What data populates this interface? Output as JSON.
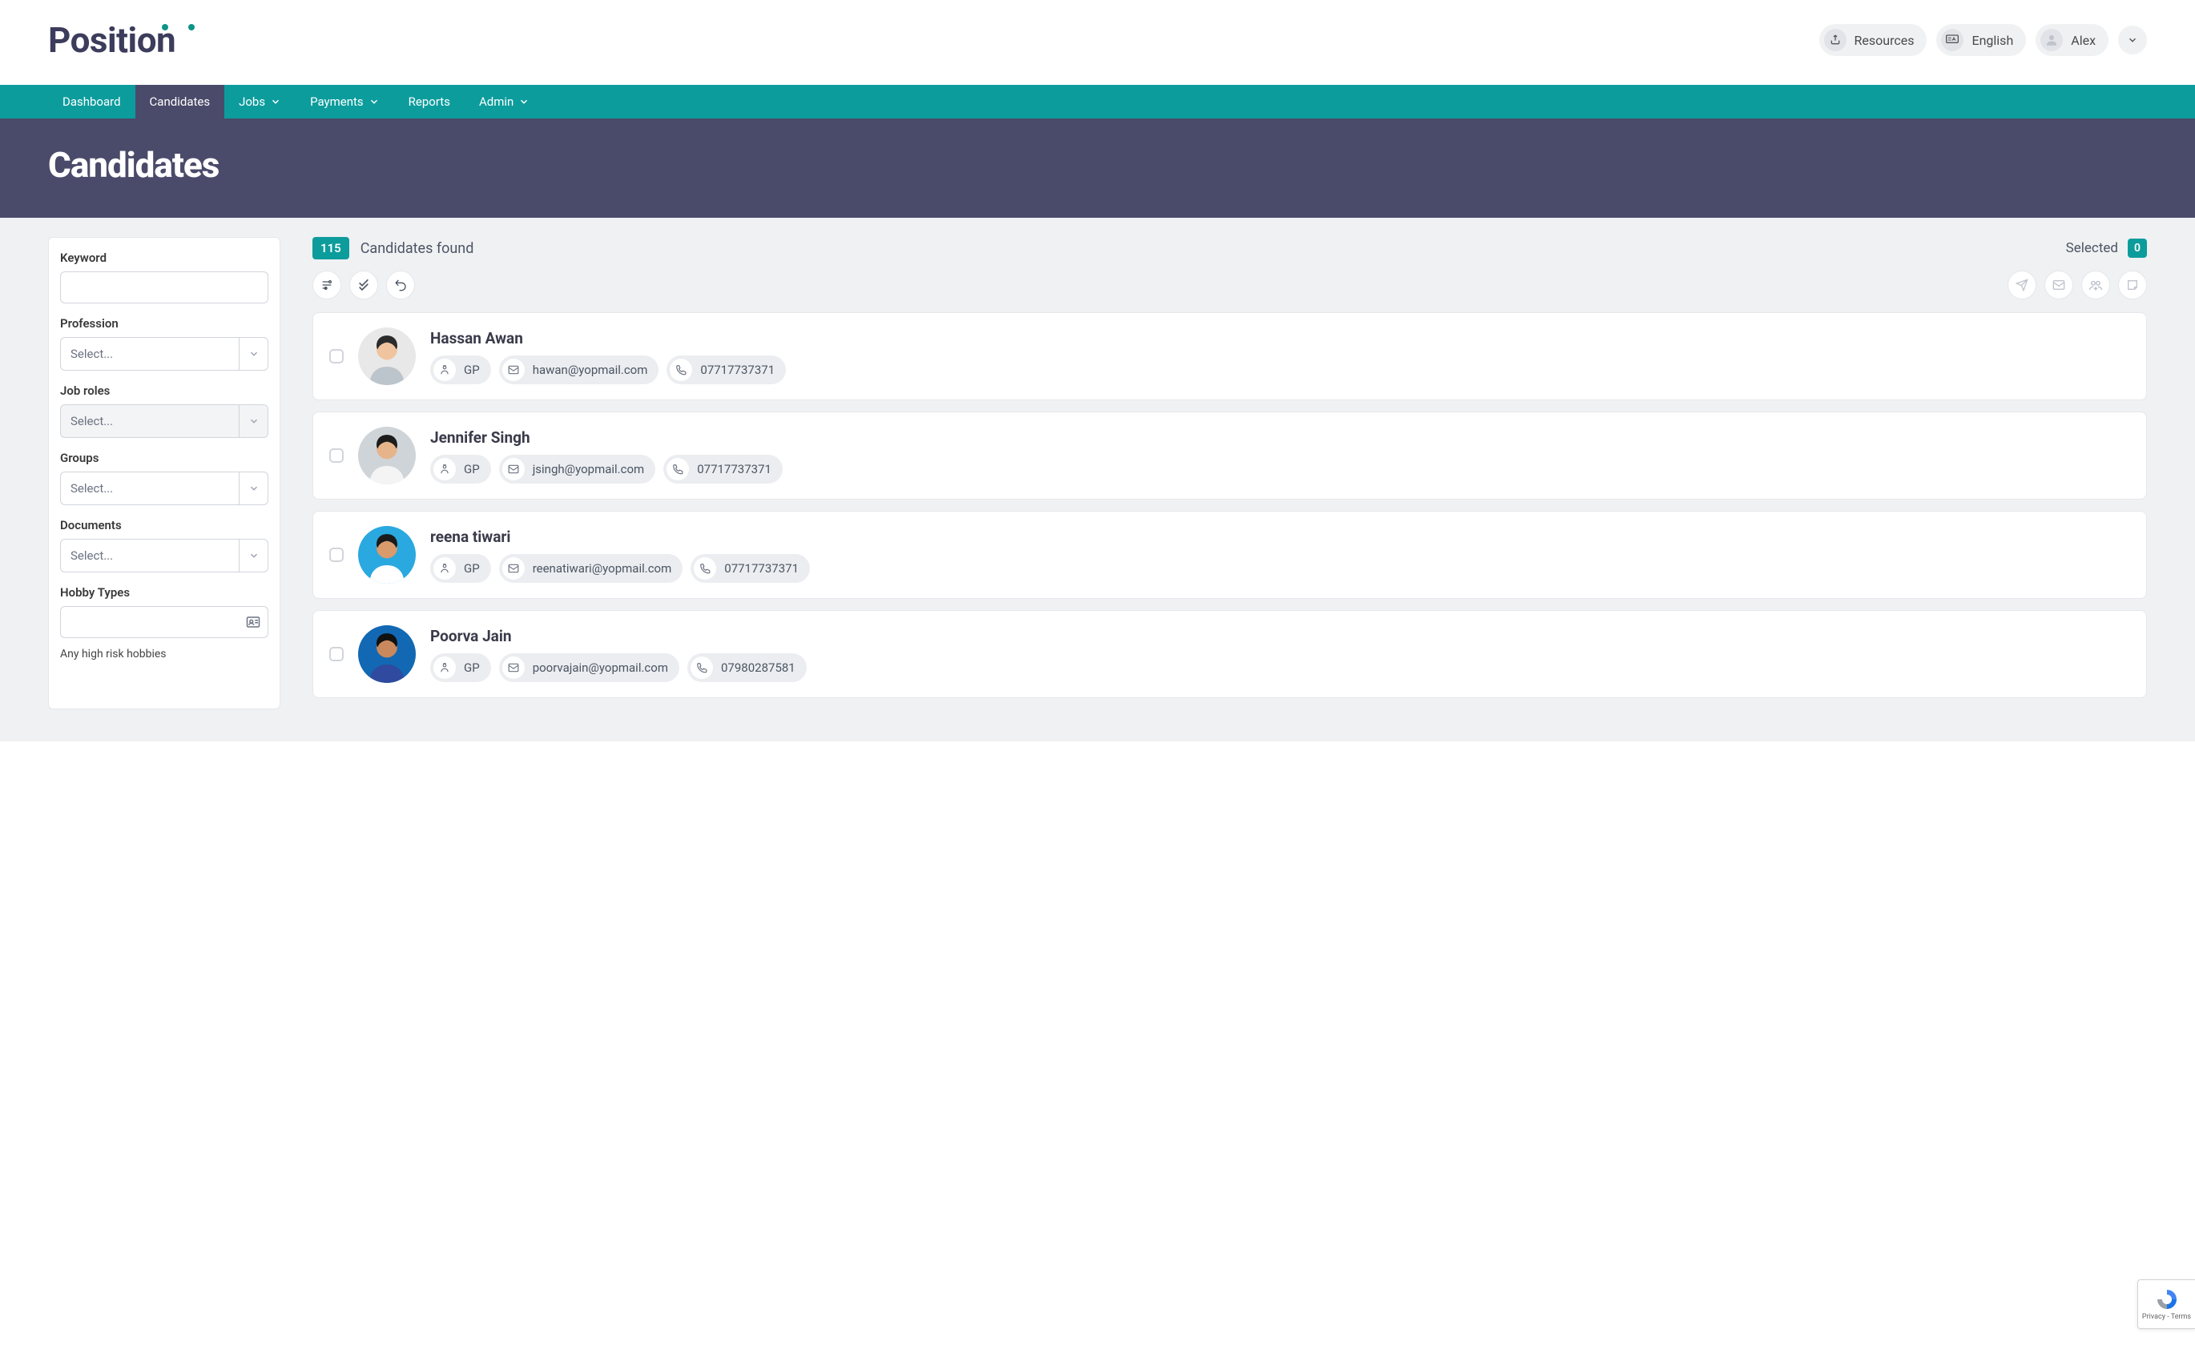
{
  "header": {
    "logo_text": "Position",
    "resources_label": "Resources",
    "language_label": "English",
    "user_name": "Alex"
  },
  "nav": {
    "items": [
      {
        "label": "Dashboard",
        "dropdown": false
      },
      {
        "label": "Candidates",
        "dropdown": false,
        "active": true
      },
      {
        "label": "Jobs",
        "dropdown": true
      },
      {
        "label": "Payments",
        "dropdown": true
      },
      {
        "label": "Reports",
        "dropdown": false
      },
      {
        "label": "Admin",
        "dropdown": true
      }
    ]
  },
  "page": {
    "title": "Candidates"
  },
  "filters": {
    "keyword": {
      "label": "Keyword",
      "value": ""
    },
    "profession": {
      "label": "Profession",
      "placeholder": "Select..."
    },
    "job_roles": {
      "label": "Job roles",
      "placeholder": "Select...",
      "disabled": true
    },
    "groups": {
      "label": "Groups",
      "placeholder": "Select..."
    },
    "documents": {
      "label": "Documents",
      "placeholder": "Select..."
    },
    "hobby_types": {
      "label": "Hobby Types",
      "value": "",
      "hint": "Any high risk hobbies"
    }
  },
  "summary": {
    "count": "115",
    "found_label": "Candidates found",
    "selected_label": "Selected",
    "selected_count": "0"
  },
  "candidates": [
    {
      "name": "Hassan Awan",
      "role": "GP",
      "email": "hawan@yopmail.com",
      "phone": "07717737371"
    },
    {
      "name": "Jennifer Singh",
      "role": "GP",
      "email": "jsingh@yopmail.com",
      "phone": "07717737371"
    },
    {
      "name": "reena tiwari",
      "role": "GP",
      "email": "reenatiwari@yopmail.com",
      "phone": "07717737371"
    },
    {
      "name": "Poorva Jain",
      "role": "GP",
      "email": "poorvajain@yopmail.com",
      "phone": "07980287581"
    }
  ],
  "recaptcha": {
    "line1": "Privacy",
    "line2": "Terms"
  },
  "avatar_colors": [
    {
      "bg": "#e8e8e8",
      "skin": "#f0c49e",
      "hair": "#2b2b2b",
      "shirt": "#bcc4cc"
    },
    {
      "bg": "#cfd4d9",
      "skin": "#e6b48a",
      "hair": "#1c1c1c",
      "shirt": "#f4f4f4"
    },
    {
      "bg": "#2aa8e0",
      "skin": "#d99a6c",
      "hair": "#1a1a1a",
      "shirt": "#ffffff"
    },
    {
      "bg": "#1268b3",
      "skin": "#c9895c",
      "hair": "#111111",
      "shirt": "#2f4a9e"
    }
  ]
}
